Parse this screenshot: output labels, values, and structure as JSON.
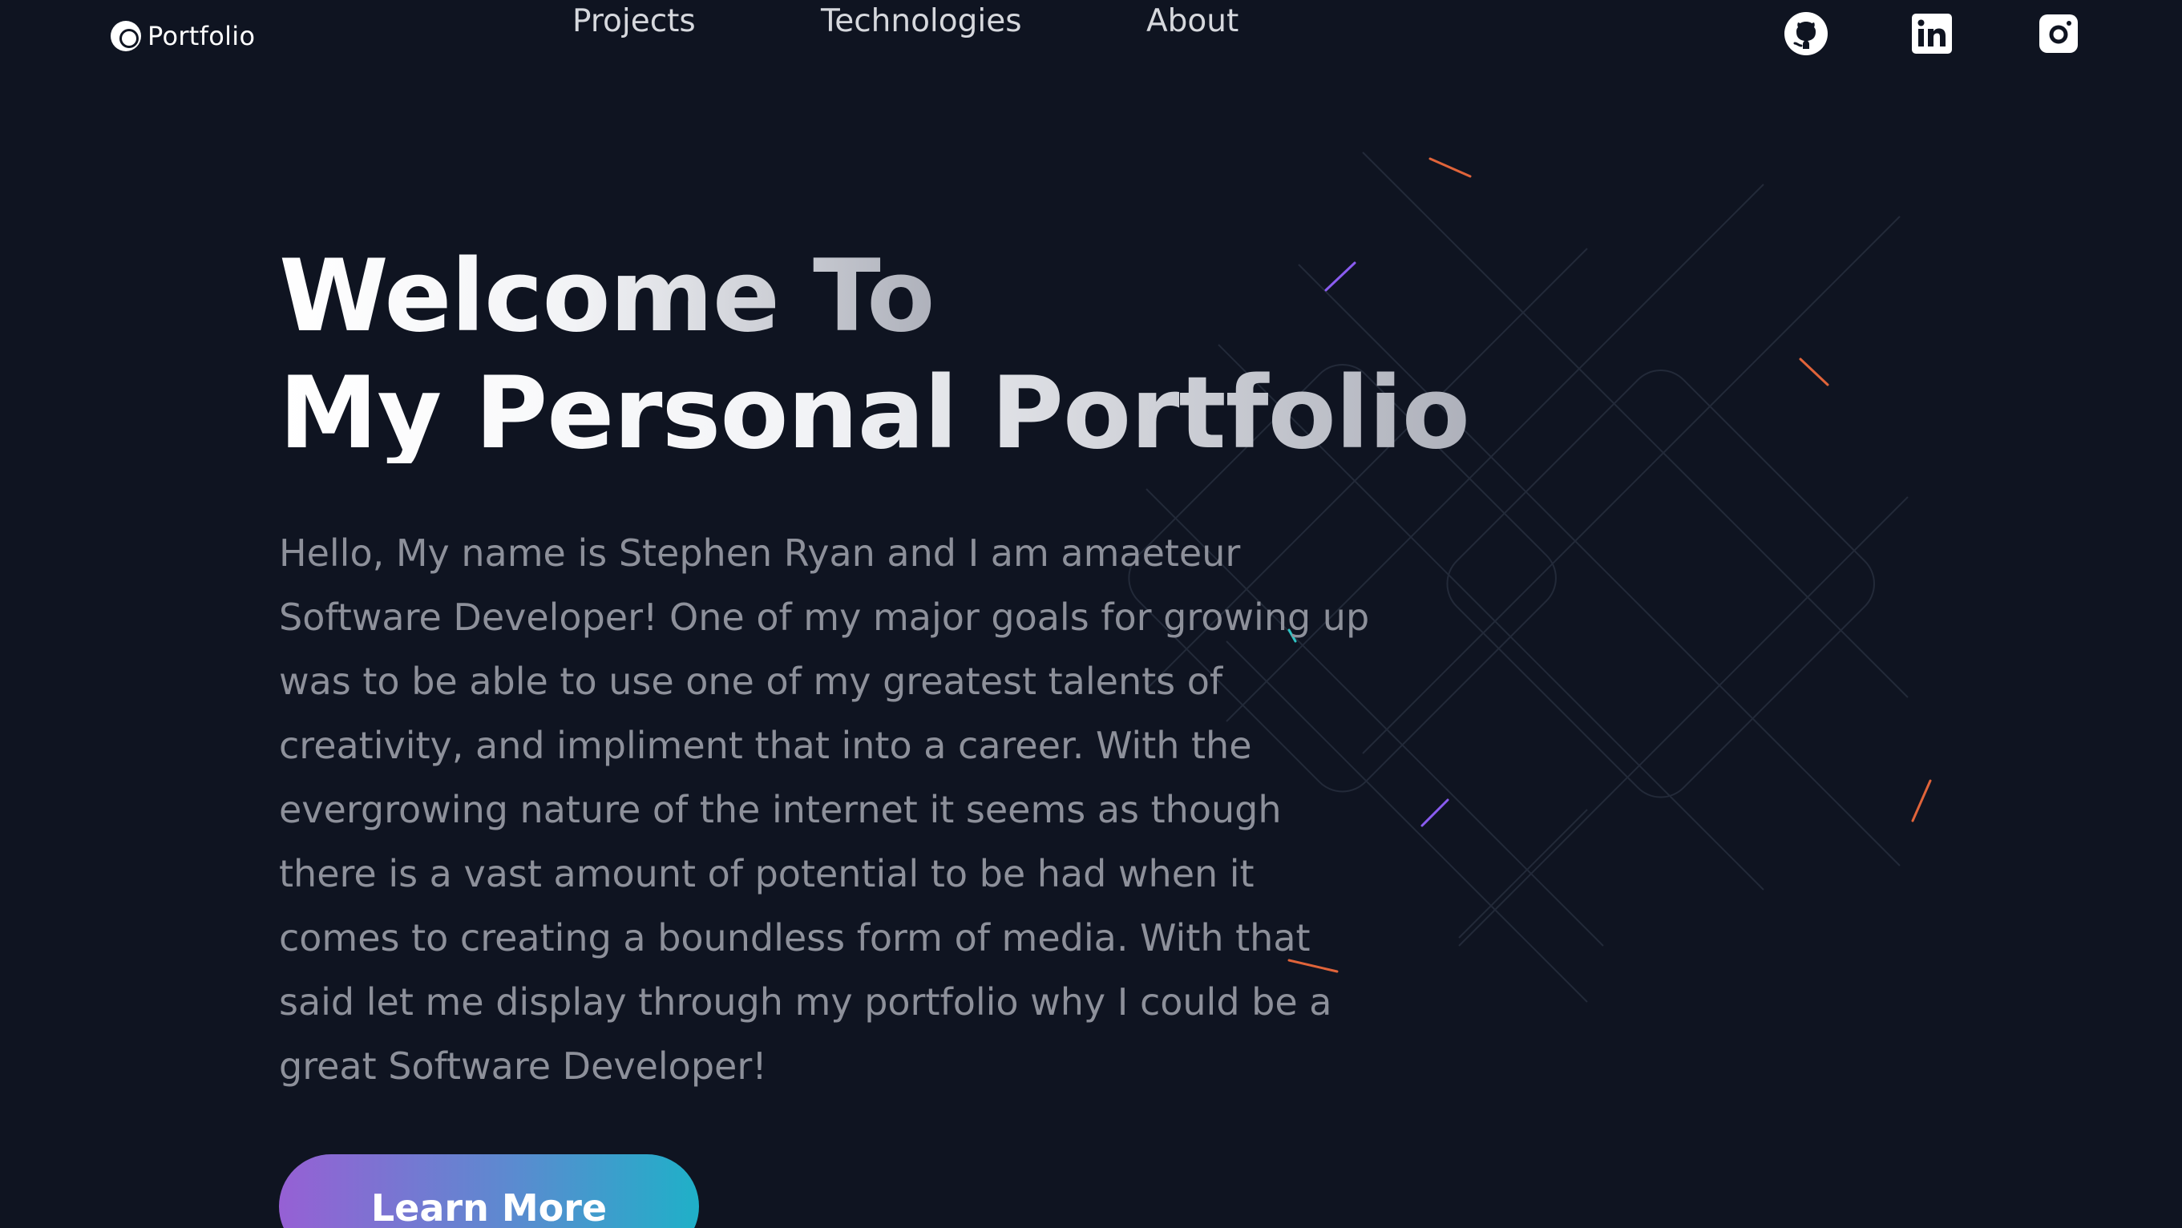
{
  "logo": {
    "label": "Portfolio"
  },
  "nav": {
    "items": [
      {
        "label": "Projects"
      },
      {
        "label": "Technologies"
      },
      {
        "label": "About"
      }
    ]
  },
  "social": [
    {
      "name": "github-icon"
    },
    {
      "name": "linkedin-icon"
    },
    {
      "name": "instagram-icon"
    }
  ],
  "hero": {
    "title_line_1": "Welcome To",
    "title_line_2": "My Personal Portfolio",
    "intro_lines": [
      "Hello, My name is Stephen Ryan and I am amaeteur",
      "Software Developer! One of my major goals for growing up",
      "was to be able to use one of my greatest talents of",
      "creativity, and impliment that into a career. With the",
      "evergrowing nature of the internet it seems as though",
      "there is a vast amount of potential to be had when it",
      "comes to creating a boundless form of media. With that",
      "said let me display through my portfolio why I could be a",
      "great Software Developer!"
    ],
    "button_label": "Learn More"
  },
  "colors": {
    "background": "#0f1421",
    "text_muted": "#8d909a",
    "nav_text": "#d6d8dd",
    "button_gradient_start": "#9660d4",
    "button_gradient_end": "#1fb0c8",
    "accent_orange": "#e0643a",
    "accent_purple": "#8a5cf0",
    "accent_teal": "#2ec4c4"
  }
}
